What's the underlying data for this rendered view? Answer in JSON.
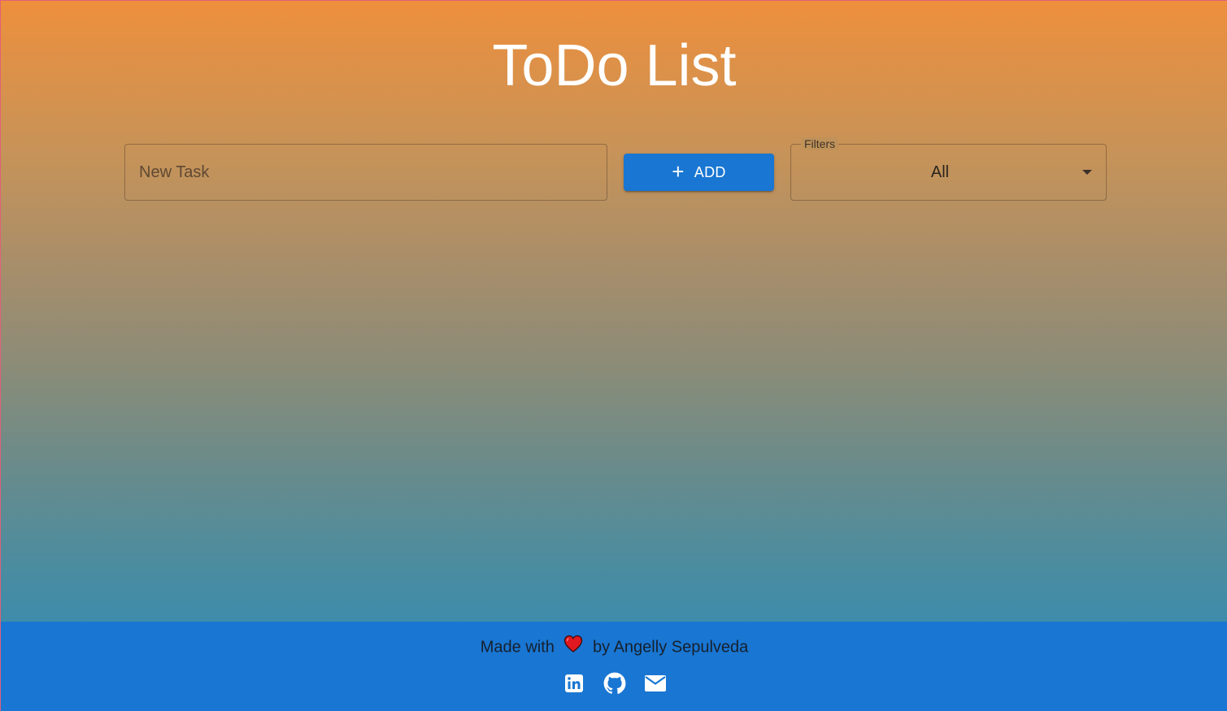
{
  "header": {
    "title": "ToDo List"
  },
  "task_form": {
    "input_value": "",
    "input_placeholder": "New Task",
    "add_button_label": "ADD",
    "add_button_icon": "plus-icon"
  },
  "filter": {
    "label": "Filters",
    "selected": "All",
    "icon": "chevron-down-icon"
  },
  "footer": {
    "made_with": "Made with",
    "author_text": "by Angelly Sepulveda",
    "heart_icon": "heart-icon",
    "links": [
      {
        "icon": "linkedin-icon"
      },
      {
        "icon": "github-icon"
      },
      {
        "icon": "email-icon"
      }
    ]
  },
  "colors": {
    "accent": "#1976d2",
    "gradient_top": "#ee8f3c",
    "gradient_bottom": "#2a8dbd",
    "heart": "#e0181f"
  }
}
